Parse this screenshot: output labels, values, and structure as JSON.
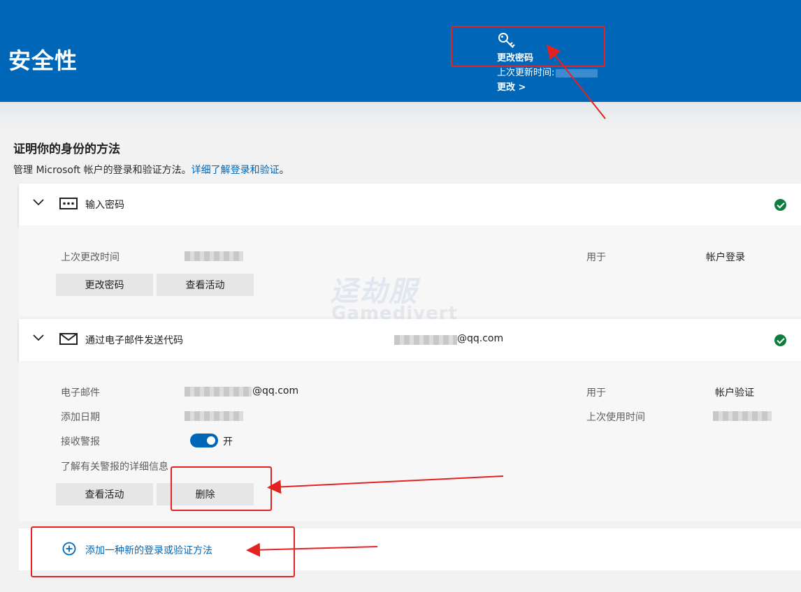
{
  "header": {
    "title": "安全性",
    "password": {
      "icon": "key-icon",
      "title": "更改密码",
      "updated_label": "上次更新时间:",
      "change_link": "更改 >"
    }
  },
  "section": {
    "heading": "证明你的身份的方法",
    "description": "管理 Microsoft 帐户的登录和验证方法。",
    "learn_link": "详细了解登录和验证",
    "period": "。"
  },
  "methods": [
    {
      "icon": "password-dots-icon",
      "title": "输入密码",
      "details": {
        "last_changed_label": "上次更改时间",
        "used_for_label": "用于",
        "used_for_value": "帐户登录"
      },
      "buttons": [
        "更改密码",
        "查看活动"
      ]
    },
    {
      "icon": "mail-icon",
      "title": "通过电子邮件发送代码",
      "email_suffix": "@qq.com",
      "details": {
        "email_label": "电子邮件",
        "email_suffix": "@qq.com",
        "added_label": "添加日期",
        "alerts_label": "接收警报",
        "alerts_state": "开",
        "used_for_label": "用于",
        "used_for_value": "帐户验证",
        "last_used_label": "上次使用时间",
        "alerts_link": "了解有关警报的详细信息"
      },
      "buttons": [
        "查看活动",
        "删除"
      ]
    }
  ],
  "add_method": {
    "icon": "plus-circle-icon",
    "label": "添加一种新的登录或验证方法"
  },
  "watermark": {
    "text_cn": "迳劫服",
    "text_en": "Gamedivert"
  },
  "colors": {
    "accent": "#0067b8",
    "success": "#107c41",
    "annotation": "#e52222"
  }
}
